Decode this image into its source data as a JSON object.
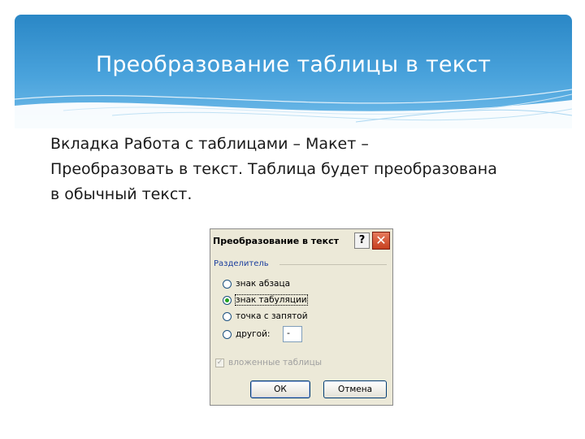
{
  "slide": {
    "title": "Преобразование таблицы в текст",
    "body_lines": [
      "Вкладка  Работа с таблицами – Макет  –",
      "Преобразовать в текст. Таблица будет преобразована",
      "в обычный текст."
    ]
  },
  "dialog": {
    "title": "Преобразование в текст",
    "help_glyph": "?",
    "close_glyph": "✕",
    "group_label": "Разделитель",
    "options": [
      {
        "label": "знак абзаца",
        "checked": false
      },
      {
        "label": "знак табуляции",
        "checked": true
      },
      {
        "label": "точка с запятой",
        "checked": false
      },
      {
        "label": "другой:",
        "checked": false
      }
    ],
    "other_value": "-",
    "nested_tables_label": "вложенные таблицы",
    "nested_tables_checked": true,
    "ok_label": "ОК",
    "cancel_label": "Отмена"
  },
  "colors": {
    "header_gradient_top": "#2a87c6",
    "header_gradient_bottom": "#74bdea",
    "dialog_bg": "#ece9d8",
    "group_label": "#1c3f9e"
  }
}
